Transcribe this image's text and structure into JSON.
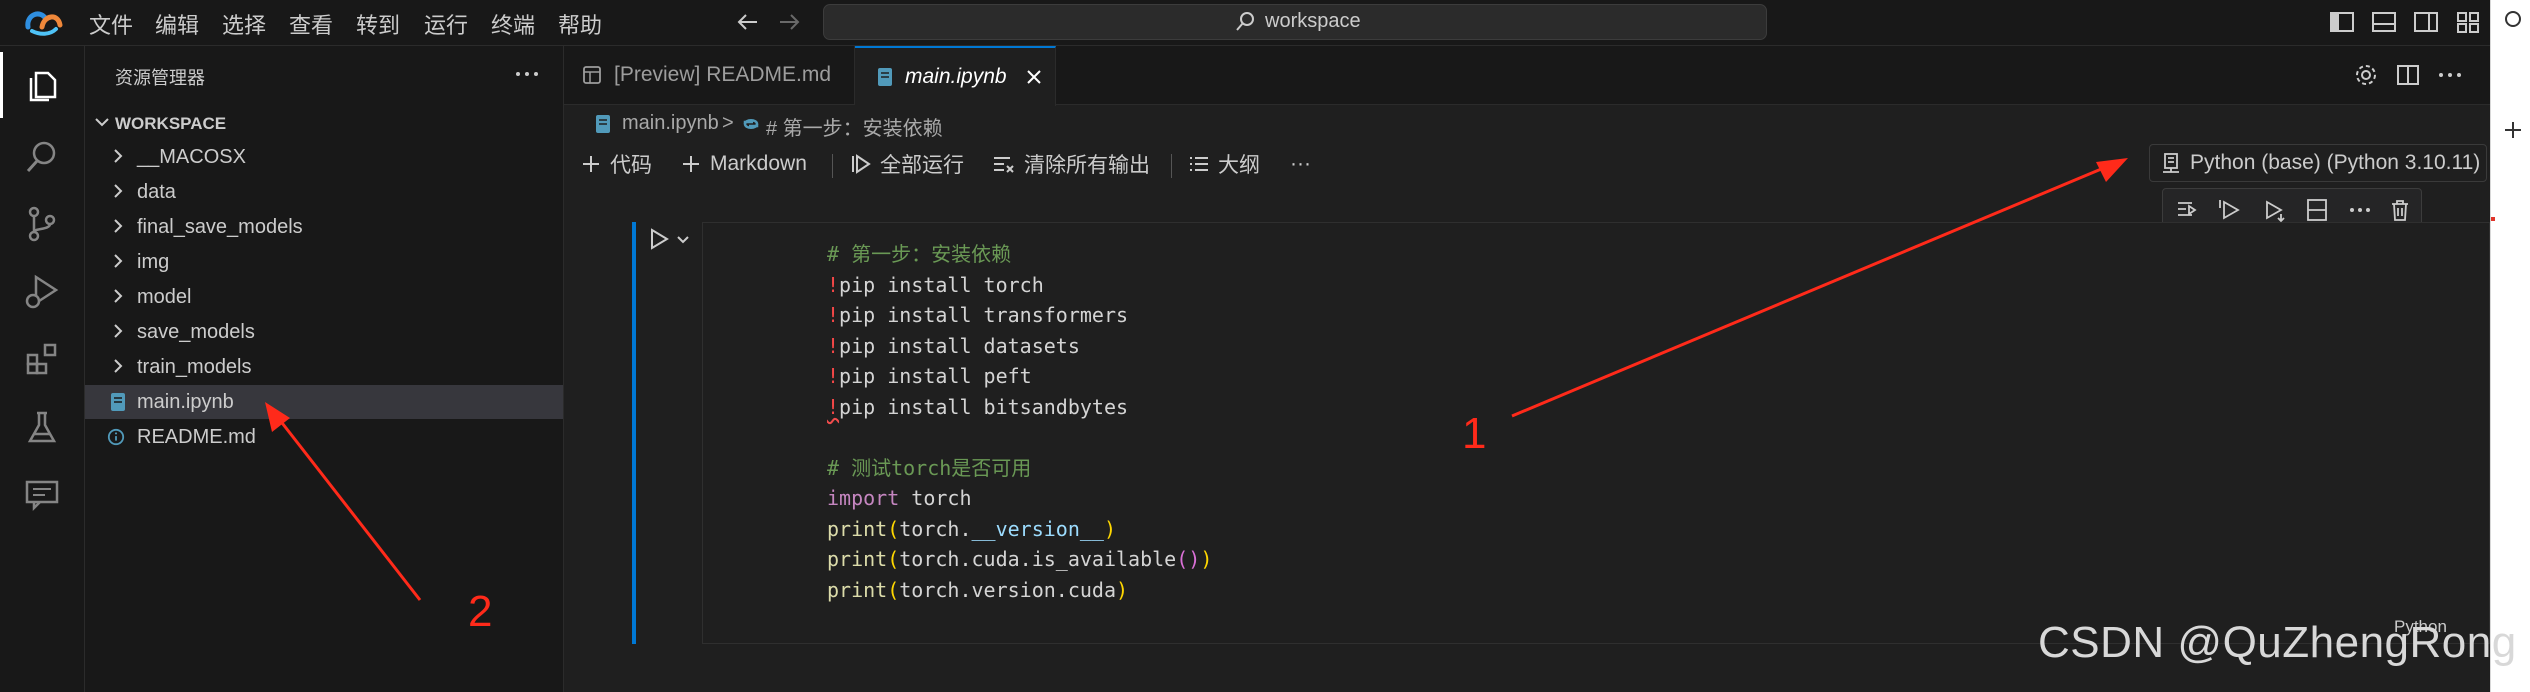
{
  "titlebar": {
    "menu": [
      "文件",
      "编辑",
      "选择",
      "查看",
      "转到",
      "运行",
      "终端",
      "帮助"
    ],
    "search_text": "workspace"
  },
  "activitybar": {
    "items": [
      "explorer-icon",
      "search-icon",
      "source-control-icon",
      "run-debug-icon",
      "extensions-icon",
      "testing-icon",
      "remote-chat-icon"
    ]
  },
  "sidebar": {
    "title": "资源管理器",
    "root": "WORKSPACE",
    "folders": [
      "__MACOSX",
      "data",
      "final_save_models",
      "img",
      "model",
      "save_models",
      "train_models"
    ],
    "files": [
      "main.ipynb",
      "README.md"
    ]
  },
  "tabs": [
    {
      "label": "[Preview] README.md"
    },
    {
      "label": "main.ipynb"
    }
  ],
  "breadcrumb": {
    "file": "main.ipynb",
    "sep": ">",
    "section": "# 第一步：安装依赖"
  },
  "toolbar": {
    "code": "代码",
    "markdown": "Markdown",
    "run_all": "全部运行",
    "clear_outputs": "清除所有输出",
    "outline": "大纲",
    "more": "···"
  },
  "kernel": {
    "label": "Python (base) (Python 3.10.11)"
  },
  "cell": {
    "language": "Python",
    "lines": {
      "l1": "# 第一步：安装依赖",
      "l2_cmd": "pip install torch",
      "l3_cmd": "pip install transformers",
      "l4_cmd": "pip install datasets",
      "l5_cmd": "pip install peft",
      "l6_cmd": "pip install bitsandbytes",
      "l8": "# 测试torch是否可用",
      "l9_kw": "import",
      "l9_rest": " torch",
      "l10_fn": "print",
      "l10_obj": "torch.",
      "l10_attr": "__version__",
      "l11_fn": "print",
      "l11_mid": "torch.cuda.is_available",
      "l12_fn": "print",
      "l12_mid": "torch.version.cuda"
    },
    "bang": "!"
  },
  "annotations": {
    "label_1": "1",
    "label_2": "2",
    "color": "#ff2a1a"
  },
  "watermark": "CSDN @QuZhengRong",
  "colors": {
    "accent": "#0078d4",
    "background": "#1f1f1f",
    "sidebar": "#181818"
  }
}
